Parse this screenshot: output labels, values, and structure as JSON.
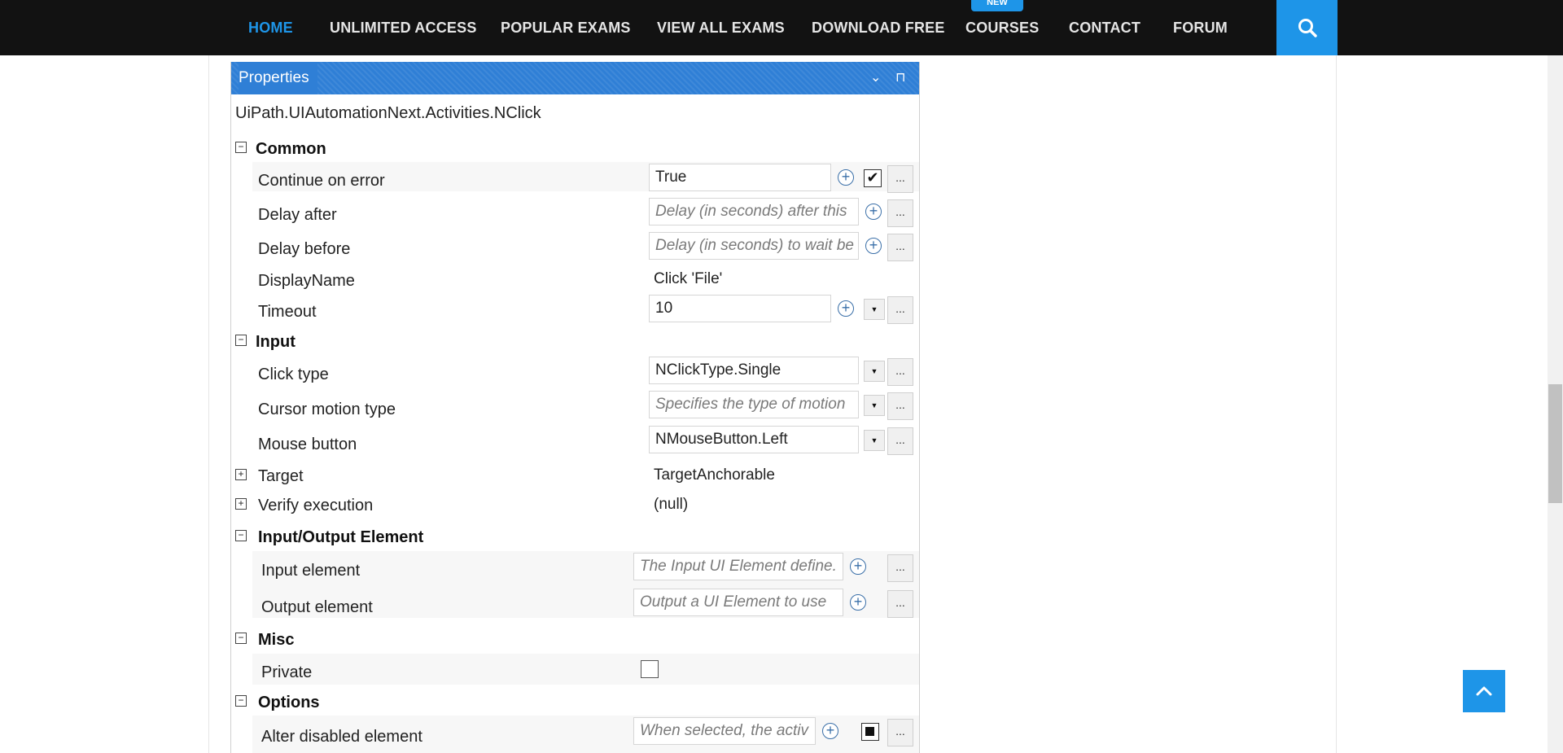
{
  "nav": {
    "items": [
      {
        "label": "HOME",
        "active": true
      },
      {
        "label": "UNLIMITED ACCESS"
      },
      {
        "label": "POPULAR EXAMS"
      },
      {
        "label": "VIEW ALL EXAMS"
      },
      {
        "label": "DOWNLOAD FREE"
      },
      {
        "label": "COURSES"
      },
      {
        "label": "CONTACT"
      },
      {
        "label": "FORUM"
      }
    ],
    "badge": "NEW",
    "search_icon": "search-icon"
  },
  "panel": {
    "title": "Properties",
    "collapse_glyph": "⌄",
    "pin_glyph": "⊓",
    "activity": "UiPath.UIAutomationNext.Activities.NClick",
    "categories": {
      "common": "Common",
      "input": "Input",
      "io": "Input/Output Element",
      "misc": "Misc",
      "options": "Options"
    },
    "props": {
      "continue_on_error": {
        "label": "Continue on error",
        "value": "True"
      },
      "delay_after": {
        "label": "Delay after",
        "placeholder": "Delay (in seconds) after this"
      },
      "delay_before": {
        "label": "Delay before",
        "placeholder": "Delay (in seconds) to wait be"
      },
      "display_name": {
        "label": "DisplayName",
        "value": "Click 'File'"
      },
      "timeout": {
        "label": "Timeout",
        "value": "10"
      },
      "click_type": {
        "label": "Click type",
        "value": "NClickType.Single"
      },
      "cursor_motion": {
        "label": "Cursor motion type",
        "placeholder": "Specifies the type of motion"
      },
      "mouse_button": {
        "label": "Mouse button",
        "value": "NMouseButton.Left"
      },
      "target": {
        "label": "Target",
        "value": "TargetAnchorable"
      },
      "verify": {
        "label": "Verify execution",
        "value": "(null)"
      },
      "input_element": {
        "label": "Input element",
        "placeholder": "The Input UI Element define."
      },
      "output_element": {
        "label": "Output element",
        "placeholder": "Output a UI Element to use"
      },
      "private": {
        "label": "Private"
      },
      "alter_disabled": {
        "label": "Alter disabled element",
        "placeholder": "When selected, the activ"
      }
    },
    "glyphs": {
      "plus": "+",
      "ellipsis": "...",
      "dropdown": "▼",
      "minus": "−",
      "expand": "+",
      "check": "✔"
    }
  },
  "colors": {
    "accent": "#1e95e8",
    "nav_bg": "#121212",
    "panel_header": "#2f7fd6"
  }
}
